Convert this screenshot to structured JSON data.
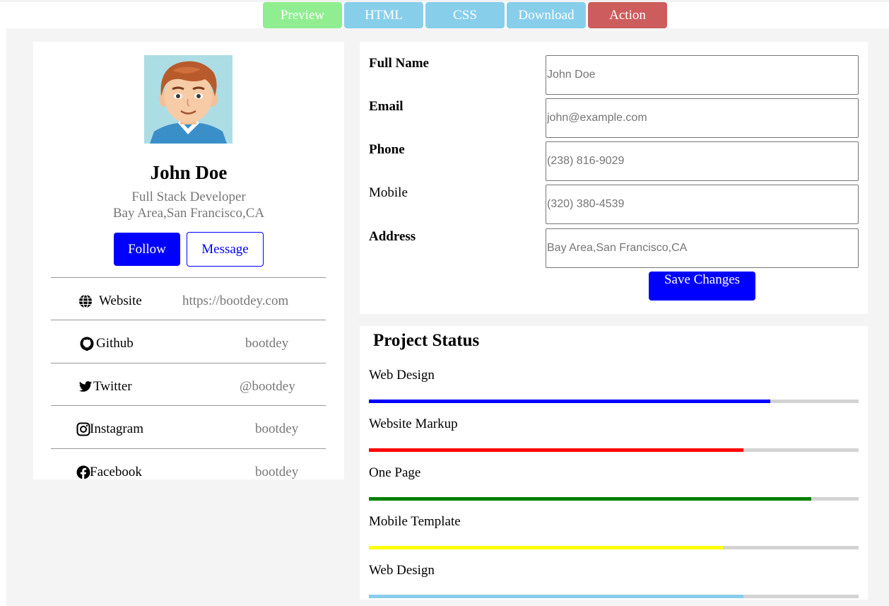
{
  "toolbar": {
    "buttons": [
      {
        "label": "Preview",
        "color": "#90ee90"
      },
      {
        "label": "HTML",
        "color": "#87ceeb"
      },
      {
        "label": "CSS",
        "color": "#87ceeb"
      },
      {
        "label": "Download",
        "color": "#87ceeb"
      },
      {
        "label": "Action",
        "color": "#cd5c5c"
      }
    ]
  },
  "profile": {
    "name": "John Doe",
    "role": "Full Stack Developer",
    "location": "Bay Area,San Francisco,CA",
    "follow_label": "Follow",
    "message_label": "Message",
    "links": [
      {
        "icon": "globe-icon",
        "label": "Website",
        "value": "https://bootdey.com"
      },
      {
        "icon": "github-icon",
        "label": "Github",
        "value": "bootdey"
      },
      {
        "icon": "twitter-icon",
        "label": "Twitter",
        "value": "@bootdey"
      },
      {
        "icon": "instagram-icon",
        "label": "Instagram",
        "value": "bootdey"
      },
      {
        "icon": "facebook-icon",
        "label": "Facebook",
        "value": "bootdey"
      }
    ]
  },
  "form": {
    "fields": [
      {
        "label": "Full Name",
        "placeholder": "John Doe",
        "bold": true
      },
      {
        "label": "Email",
        "placeholder": "john@example.com",
        "bold": true
      },
      {
        "label": "Phone",
        "placeholder": "(238) 816-9029",
        "bold": true
      },
      {
        "label": "Mobile",
        "placeholder": "(320) 380-4539",
        "bold": false
      },
      {
        "label": "Address",
        "placeholder": "Bay Area,San Francisco,CA",
        "bold": true
      }
    ],
    "save_label": "Save Changes"
  },
  "project_status": {
    "title": "Project Status",
    "items": [
      {
        "label": "Web Design",
        "percent": 82,
        "color": "#0000ff"
      },
      {
        "label": "Website Markup",
        "percent": 76.5,
        "color": "#ff0000"
      },
      {
        "label": "One Page",
        "percent": 90.3,
        "color": "#008000"
      },
      {
        "label": "Mobile Template",
        "percent": 72.3,
        "color": "#ffff00"
      },
      {
        "label": "Web Design",
        "percent": 76.5,
        "color": "#87ceeb"
      }
    ]
  }
}
